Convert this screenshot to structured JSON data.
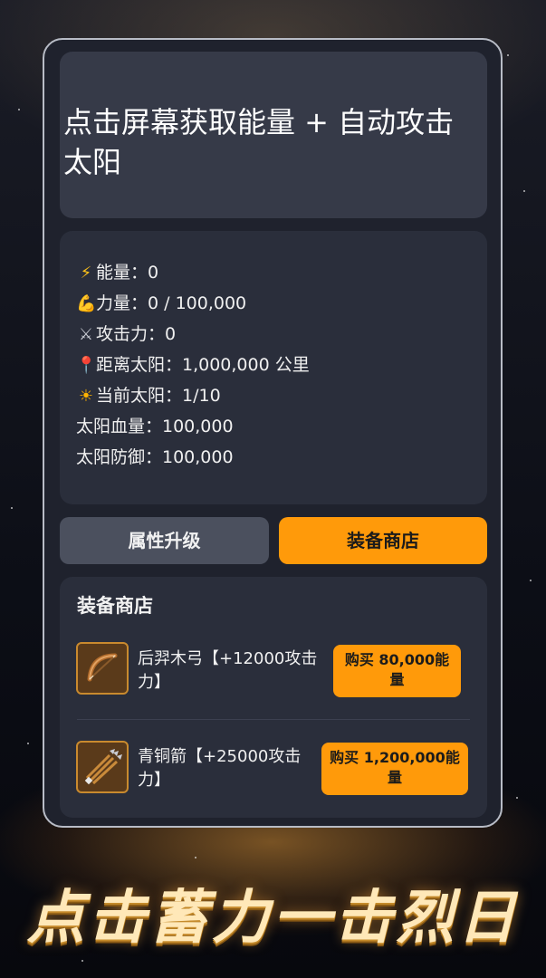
{
  "header": {
    "title": "点击屏幕获取能量 + 自动攻击太阳"
  },
  "stats": [
    {
      "icon": "lightning-icon",
      "glyph": "⚡",
      "text": "能量：0"
    },
    {
      "icon": "flexed-biceps-icon",
      "glyph": "💪",
      "text": "力量：0 / 100,000"
    },
    {
      "icon": "crossed-swords-icon",
      "glyph": "⚔",
      "text": "攻击力：0"
    },
    {
      "icon": "location-pin-icon",
      "glyph": "📍",
      "text": "距离太阳：1,000,000 公里"
    },
    {
      "icon": "sun-icon",
      "glyph": "☀",
      "text": "当前太阳：1/10"
    },
    {
      "icon": "",
      "glyph": "",
      "text": "太阳血量：100,000"
    },
    {
      "icon": "",
      "glyph": "",
      "text": "太阳防御：100,000"
    }
  ],
  "tabs": {
    "attributes": "属性升级",
    "shop": "装备商店"
  },
  "shop": {
    "title": "装备商店",
    "items": [
      {
        "icon": "bow-icon",
        "name": "后羿木弓【+12000攻击力】",
        "buy_label": "购买 80,000能量"
      },
      {
        "icon": "arrows-icon",
        "name": "青铜箭【+25000攻击力】",
        "buy_label": "购买 1,200,000能量"
      }
    ]
  },
  "banner": {
    "text": "点击蓄力一击烈日"
  },
  "colors": {
    "accent": "#ff9a0a",
    "card": "#2a2e3b",
    "header_card": "#363a48",
    "tab_inactive": "#4b505e"
  }
}
